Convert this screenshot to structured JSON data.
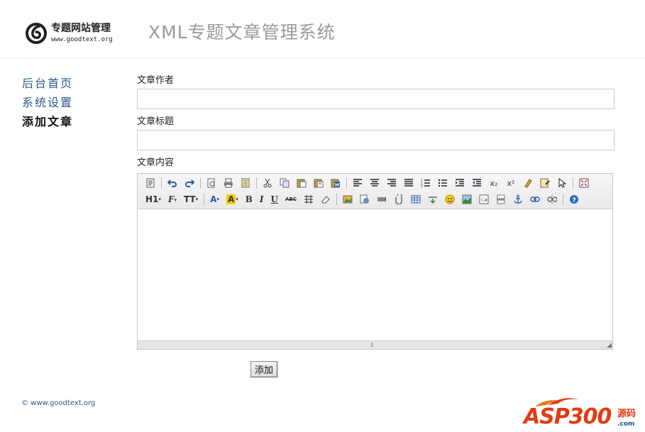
{
  "header": {
    "logo_title": "专题网站管理",
    "logo_url": "www.goodtext.org",
    "site_title": "XML专题文章管理系统"
  },
  "sidebar": {
    "items": [
      {
        "label": "后台首页"
      },
      {
        "label": "系统设置"
      },
      {
        "label": "添加文章"
      }
    ]
  },
  "form": {
    "author_label": "文章作者",
    "author_value": "",
    "title_label": "文章标题",
    "title_value": "",
    "content_label": "文章内容",
    "content_value": "",
    "submit_label": "添加"
  },
  "editor": {
    "heading_btn": "H1",
    "font_btn": "F",
    "size_btn": "TT",
    "color_btn": "A",
    "bg_color_btn": "A",
    "bold_btn": "B",
    "italic_btn": "I",
    "underline_btn": "U",
    "strike_btn": "ABC",
    "subscript_btn": "x₂",
    "superscript_btn": "x²",
    "row1_icons": [
      "source-icon",
      "undo-icon",
      "redo-icon",
      "preview-icon",
      "print-icon",
      "template-icon",
      "cut-icon",
      "copy-icon",
      "paste-icon",
      "paste-plain-icon",
      "paste-word-icon",
      "align-left-icon",
      "align-center-icon",
      "align-right-icon",
      "align-justify-icon",
      "ordered-list-icon",
      "unordered-list-icon",
      "indent-icon",
      "outdent-icon",
      "subscript-icon",
      "superscript-icon",
      "clear-format-icon",
      "select-all-icon",
      "pointer-icon",
      "fullscreen-icon"
    ],
    "row2_icons": [
      "heading-icon",
      "font-family-icon",
      "font-size-icon",
      "font-color-icon",
      "highlight-color-icon",
      "bold-icon",
      "italic-icon",
      "underline-icon",
      "strikethrough-icon",
      "line-height-icon",
      "remove-format-icon",
      "image-icon",
      "multi-image-icon",
      "flash-icon",
      "media-icon",
      "attachment-icon",
      "table-icon",
      "horizontal-rule-icon",
      "emoticon-icon",
      "map-icon",
      "code-icon",
      "page-break-icon",
      "anchor-icon",
      "link-icon",
      "unlink-icon",
      "help-icon"
    ]
  },
  "footer": {
    "copyright": "© www.goodtext.org"
  },
  "brand": {
    "name": "ASP300",
    "cn": "源码",
    "com": ".com"
  },
  "colors": {
    "nav_link": "#2a5a8a",
    "brand_red": "#e23a12",
    "site_title": "#999999"
  }
}
